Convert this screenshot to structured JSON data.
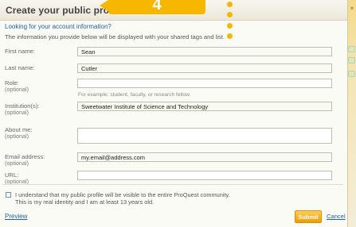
{
  "dialog": {
    "title": "Create your public profile",
    "account_link": "Looking for your account information?",
    "intro": "The information you provide below will be displayed with your shared tags and list."
  },
  "callout": {
    "number": "4",
    "color": "#F7B600"
  },
  "form": {
    "first_name": {
      "label": "First name:",
      "value": "Sean"
    },
    "last_name": {
      "label": "Last name:",
      "value": "Cutler"
    },
    "role": {
      "label": "Role:",
      "optional": "(optional)",
      "value": "",
      "hint": "For example: student, faculty, or research fellow."
    },
    "institution": {
      "label": "Institution(s):",
      "optional": "(optional)",
      "value": "Sweetwater Institute of Science and Technology"
    },
    "about": {
      "label": "About me:",
      "optional": "(optional)",
      "value": ""
    },
    "email": {
      "label": "Email address:",
      "optional": "(optional)",
      "value": "my.email@address.com"
    },
    "url": {
      "label": "URL:",
      "optional": "(optional)",
      "value": ""
    }
  },
  "consent": {
    "line1": "I understand that my public profile will be visible to the entire ProQuest community.",
    "line2": "This is my real identity and I am at least 13 years old."
  },
  "footer": {
    "preview_label": "Preview",
    "submit_label": "Submit",
    "cancel_label": "Cancel"
  },
  "gutter": {
    "close_icon": "close-icon"
  },
  "colors": {
    "accent": "#F7B600",
    "link": "#215FA2",
    "panel_bg": "#FBFBF6"
  }
}
